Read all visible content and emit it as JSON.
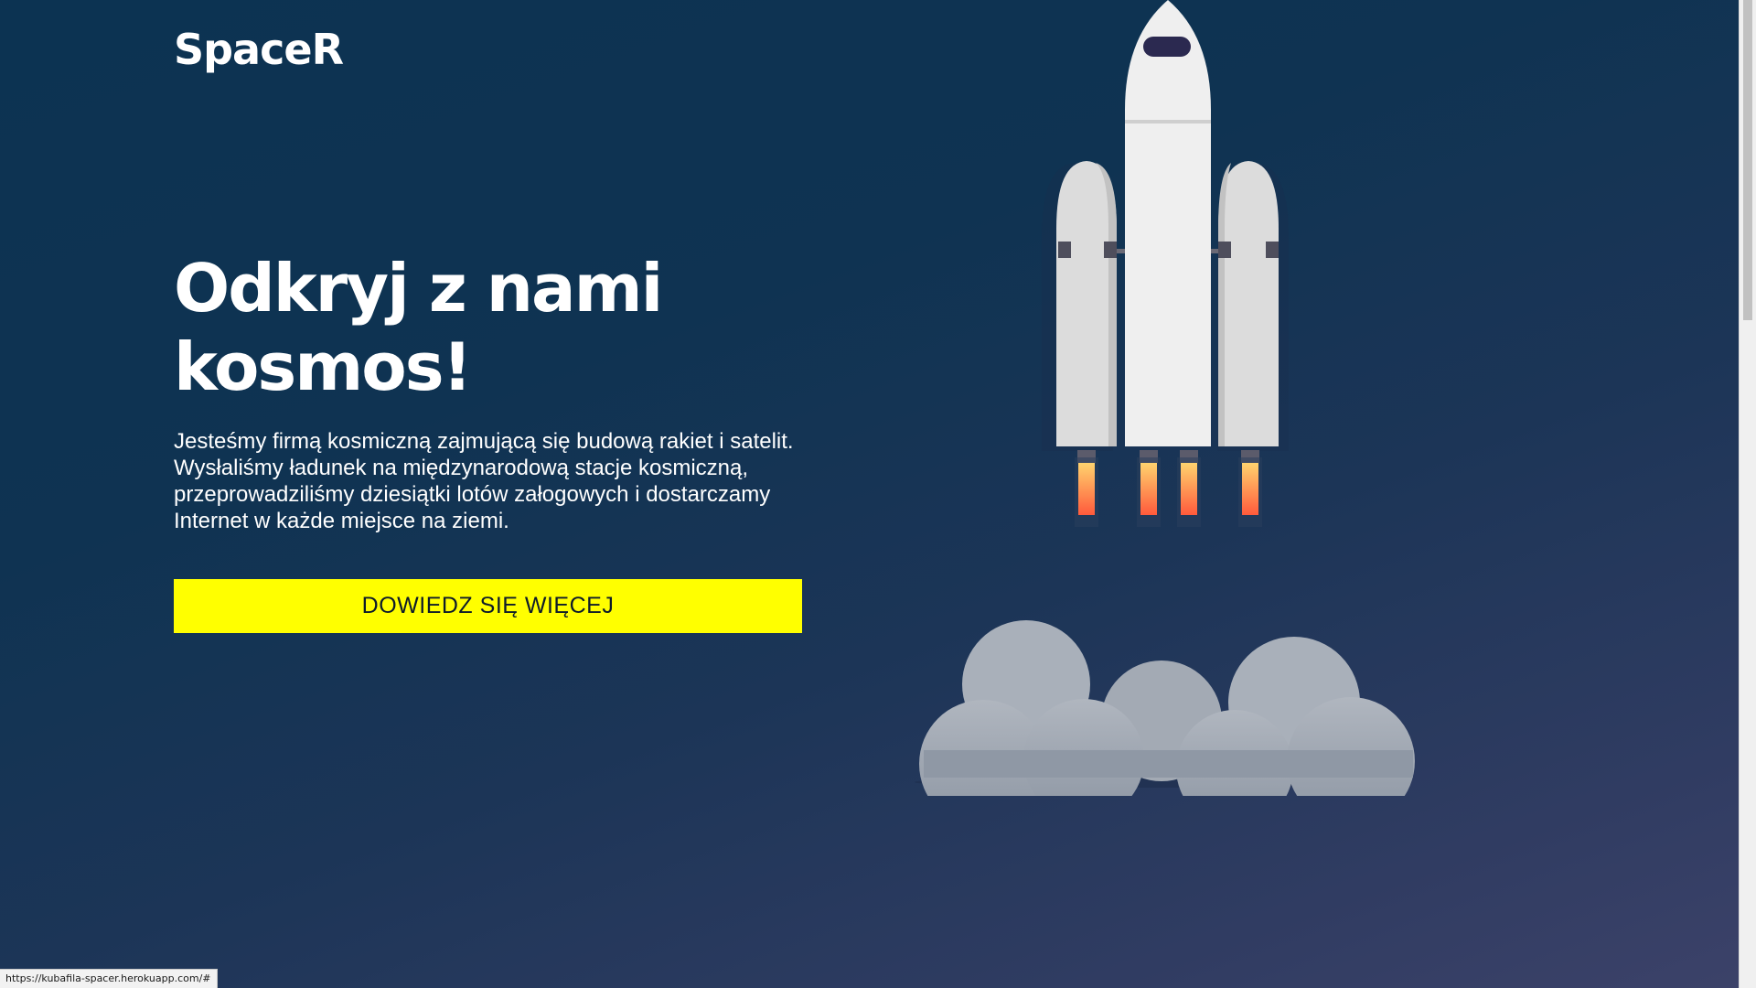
{
  "header": {
    "logo_text": "SpaceR"
  },
  "hero": {
    "title_line1": "Odkryj z nami",
    "title_line2": "kosmos!",
    "description": "Jesteśmy firmą kosmiczną zajmującą się budową rakiet i satelit. Wysłaliśmy ładunek na międzynarodową stacje kosmiczną, przeprowadziliśmy dziesiątki lotów załogowych i dostarczamy Internet w każde miejsce na ziemi.",
    "cta_label": "DOWIEDZ SIĘ WIĘCEJ"
  },
  "illustration": {
    "icon": "rocket-launch-illustration"
  },
  "status_bar": {
    "url": "https://kubafila-spacer.herokuapp.com/#"
  },
  "colors": {
    "background_top": "#0c3352",
    "background_bottom": "#3c4269",
    "cta_background": "#ffff00",
    "cta_text": "#0d1b2a",
    "rocket_body": "#efefef",
    "flame_top": "#ffd36e",
    "flame_bottom": "#ff5a3c",
    "cloud": "#9ba3ae"
  }
}
